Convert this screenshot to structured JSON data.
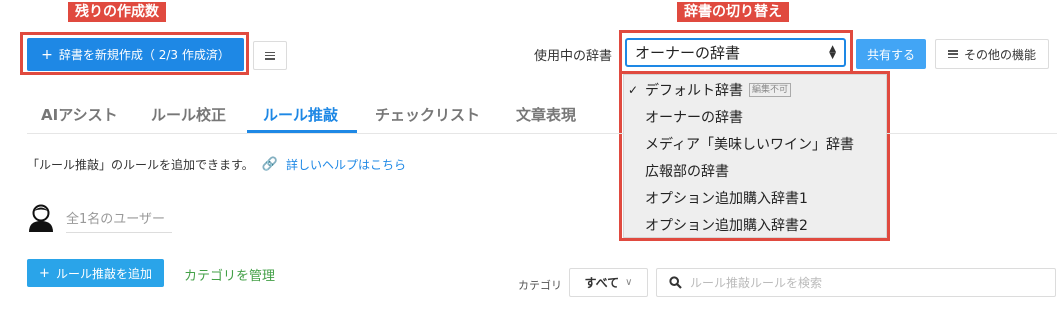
{
  "annotations": {
    "left_label": "残りの作成数",
    "right_label": "辞書の切り替え"
  },
  "toolbar": {
    "add_dictionary_label": "辞書を新規作成（ 2/3 作成済）",
    "dictionary_label": "使用中の辞書",
    "selected_dictionary": "オーナーの辞書",
    "share_label": "共有する",
    "other_functions_label": "その他の機能"
  },
  "dropdown": {
    "items": [
      {
        "label": "デフォルト辞書",
        "badge": "編集不可",
        "checked": true
      },
      {
        "label": "オーナーの辞書",
        "badge": "",
        "checked": false
      },
      {
        "label": "メディア「美味しいワイン」辞書",
        "badge": "",
        "checked": false
      },
      {
        "label": "広報部の辞書",
        "badge": "",
        "checked": false
      },
      {
        "label": "オプション追加購入辞書1",
        "badge": "",
        "checked": false
      },
      {
        "label": "オプション追加購入辞書2",
        "badge": "",
        "checked": false
      }
    ]
  },
  "tabs": [
    {
      "label": "AIアシスト",
      "active": false
    },
    {
      "label": "ルール校正",
      "active": false
    },
    {
      "label": "ルール推敲",
      "active": true
    },
    {
      "label": "チェックリスト",
      "active": false
    },
    {
      "label": "文章表現",
      "active": false
    }
  ],
  "content": {
    "description": "「ルール推敲」のルールを追加できます。",
    "help_link": "詳しいヘルプはこちら",
    "user_filter": "全1名のユーザー",
    "add_rule_label": "ルール推敲を追加",
    "manage_category_label": "カテゴリを管理",
    "category_label": "カテゴリ",
    "category_value": "すべて",
    "search_placeholder": "ルール推敲ルールを検索"
  },
  "colors": {
    "accent": "#1e88e5",
    "callout": "#e04a3f",
    "link_green": "#43a047"
  }
}
